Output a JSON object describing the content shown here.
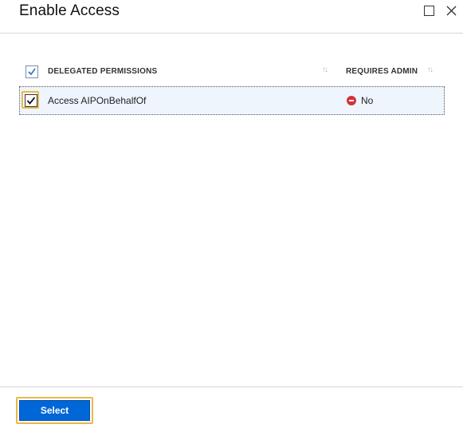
{
  "header": {
    "title": "Enable Access"
  },
  "table": {
    "columns": [
      {
        "label": "DELEGATED PERMISSIONS"
      },
      {
        "label": "REQUIRES ADMIN"
      }
    ],
    "header_checked": true,
    "rows": [
      {
        "permission": "Access AIPOnBehalfOf",
        "requires_admin": "No",
        "checked": true
      }
    ]
  },
  "footer": {
    "select_label": "Select"
  },
  "colors": {
    "accent": "#0067d8",
    "highlight": "#e8b84a",
    "status_no": "#d13438",
    "row_selected_bg": "#eef5fd"
  },
  "icons": {
    "maximize": "maximize-icon",
    "close": "close-icon",
    "sort": "sort-icon",
    "checkmark": "checkmark-icon",
    "status": "blocked-icon"
  }
}
